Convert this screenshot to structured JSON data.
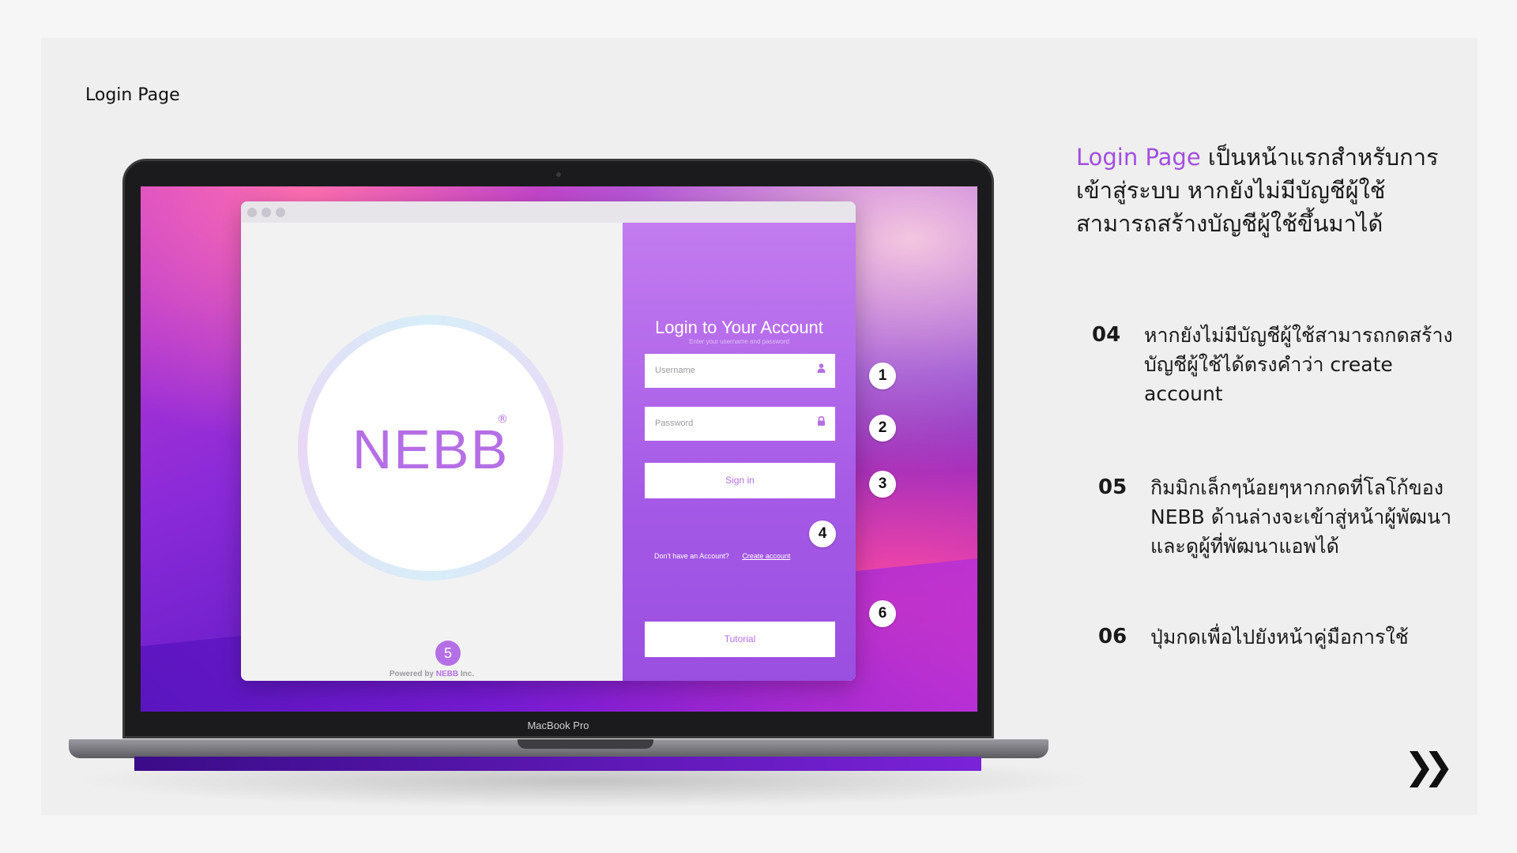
{
  "slide": {
    "page_label": "Login Page",
    "description_highlight": "Login Page",
    "description_rest": " เป็นหน้าแรกสำหรับการเข้าสู่ระบบ หากยังไม่มีบัญชีผู้ใช้สามารถสร้างบัญชีผู้ใช้ขึ้นมาได้",
    "items": [
      {
        "num": "04",
        "text": "หากยังไม่มีบัญชีผู้ใช้สามารถกดสร้างบัญชีผู้ใช้ได้ตรงคำว่า create account"
      },
      {
        "num": "05",
        "text": "กิมมิกเล็กๆน้อยๆหากกดที่โลโก้ของ NEBB ด้านล่างจะเข้าสู่หน้าผู้พัฒนาและดูผู้ที่พัฒนาแอพได้"
      },
      {
        "num": "06",
        "text": "ปุ่มกดเพื่อไปยังหน้าคู่มือการใช้"
      }
    ],
    "next_glyph": "❯❯"
  },
  "laptop": {
    "model_label": "MacBook Pro"
  },
  "app": {
    "logo_text": "NEBB",
    "logo_reg": "®",
    "title": "Login to Your Account",
    "subtitle": "Enter your username and password",
    "username_placeholder": "Username",
    "password_placeholder": "Password",
    "signin_label": "Sign in",
    "no_account_text": "Don't have an Account?",
    "create_account_label": "Create account",
    "tutorial_label": "Tutorial",
    "powered_prefix": "Powered by",
    "powered_brand": "NEBB",
    "powered_suffix": "Inc.",
    "user_icon": "user-icon",
    "lock_icon": "lock-icon"
  },
  "badges": [
    "1",
    "2",
    "3",
    "4",
    "5",
    "6"
  ],
  "colors": {
    "accent": "#b56fe6",
    "highlight_text": "#a24ee0"
  }
}
